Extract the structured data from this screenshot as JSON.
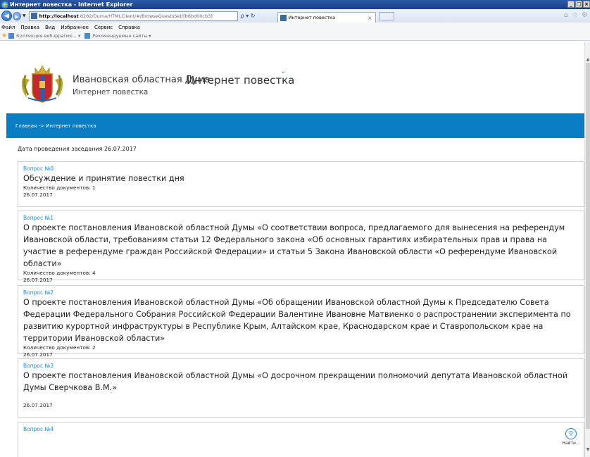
{
  "window": {
    "title": "Интернет повестка - Internet Explorer",
    "controls": [
      "_",
      "□",
      "×"
    ]
  },
  "navbar": {
    "back_glyph": "◀",
    "forward_glyph": "▶",
    "address_host": "http://localhost",
    "address_rest": ":8282/Duma/HTMLClient/#/BrowseQuestsSet/[b6bd00cb3]",
    "addr_tools": "ρ ▾ ↻",
    "tab_title": "Интернет повестка",
    "tab_close": "×",
    "right_icons": [
      "⌂",
      "☆",
      "⚙"
    ]
  },
  "menubar": {
    "items": [
      "Файл",
      "Правка",
      "Вид",
      "Избранное",
      "Сервис",
      "Справка"
    ]
  },
  "favbar": {
    "items": [
      "Коллекция веб-фрагме...  ▾",
      "Рекомендуемые сайты ▾"
    ]
  },
  "header": {
    "org_name": "Ивановская областная Дума",
    "site_subtitle": "Интернет повестка",
    "site_title": "Интернет повестка"
  },
  "breadcrumb": "Главная -> Интернет повестка",
  "session_date": "Дата проведения заседания 26.07.2017",
  "questions": [
    {
      "number": "Вопрос №0",
      "title": "Обсуждение и принятие повестки дня",
      "docs": "Количество документов: 1",
      "date": "26.07.2017"
    },
    {
      "number": "Вопрос №1",
      "title": "О проекте постановления Ивановской областной Думы «О соответствии вопроса, предлагаемого для вынесения на референдум Ивановской области, требованиям статьи 12 Федерального закона «Об основных гарантиях избирательных прав и права на участие в референдуме граждан Российской Федерации» и статьи 5 Закона Ивановской области «О референдуме Ивановской области»",
      "docs": "Количество документов: 4",
      "date": "26.07.2017"
    },
    {
      "number": "Вопрос №2",
      "title": "О проекте постановления Ивановской областной Думы «Об обращении Ивановской областной Думы к Председателю Совета Федерации Федерального Собрания Российской Федерации Валентине Ивановне Матвиенко о распространении эксперимента по развитию курортной инфраструктуры в Республике Крым, Алтайском крае, Краснодарском крае и Ставропольском крае на территории Ивановской области»",
      "docs": "Количество документов: 2",
      "date": "26.07.2017"
    },
    {
      "number": "Вопрос №3",
      "title": "О проекте постановления Ивановской областной Думы «О досрочном прекращении полномочий депутата Ивановской областной Думы Сверчкова В.М.»",
      "docs": "",
      "date": "26.07.2017"
    },
    {
      "number": "Вопрос №4",
      "title": "",
      "docs": "",
      "date": ""
    }
  ],
  "find_button": {
    "label": "Найти..."
  },
  "colors": {
    "accent": "#0b7dc4",
    "link": "#1b8cd8"
  }
}
